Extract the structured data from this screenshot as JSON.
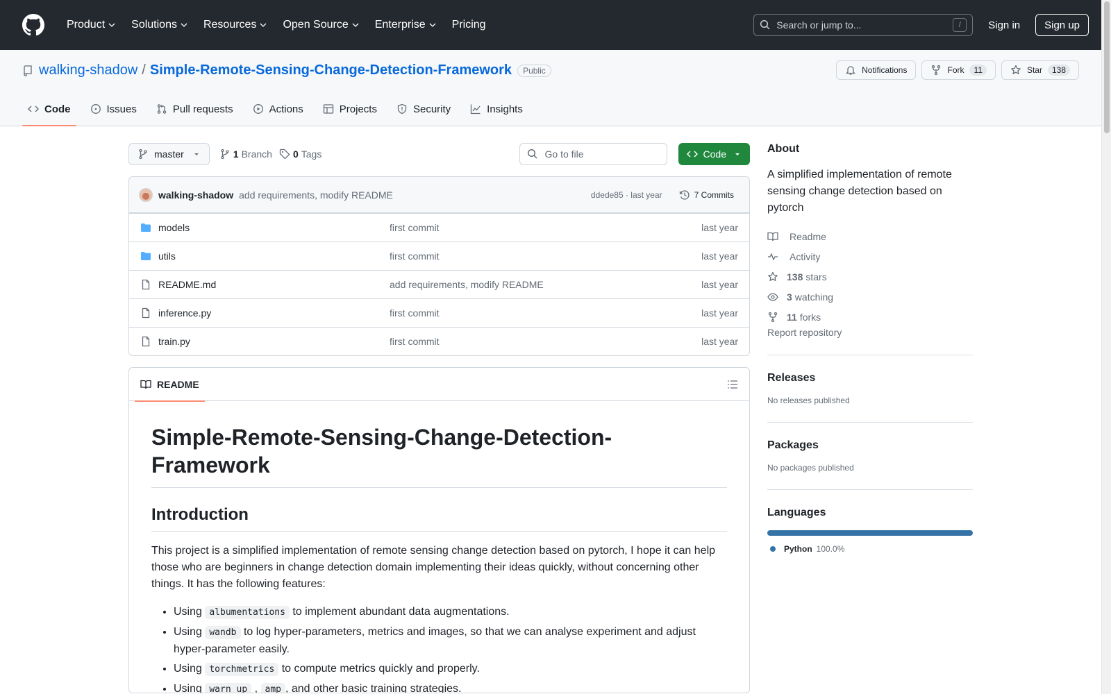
{
  "header": {
    "nav": [
      {
        "label": "Product",
        "caret": true
      },
      {
        "label": "Solutions",
        "caret": true
      },
      {
        "label": "Resources",
        "caret": true
      },
      {
        "label": "Open Source",
        "caret": true
      },
      {
        "label": "Enterprise",
        "caret": true
      },
      {
        "label": "Pricing",
        "caret": false
      }
    ],
    "search_placeholder": "Search or jump to...",
    "search_shortcut": "/",
    "sign_in": "Sign in",
    "sign_up": "Sign up"
  },
  "repo": {
    "owner": "walking-shadow",
    "separator": "/",
    "name": "Simple-Remote-Sensing-Change-Detection-Framework",
    "visibility": "Public",
    "notifications_label": "Notifications",
    "fork_label": "Fork",
    "fork_count": "11",
    "star_label": "Star",
    "star_count": "138",
    "tabs": [
      {
        "label": "Code",
        "icon": "code-icon",
        "active": true
      },
      {
        "label": "Issues",
        "icon": "issue-icon"
      },
      {
        "label": "Pull requests",
        "icon": "pull-request-icon"
      },
      {
        "label": "Actions",
        "icon": "play-icon"
      },
      {
        "label": "Projects",
        "icon": "table-icon"
      },
      {
        "label": "Security",
        "icon": "shield-icon"
      },
      {
        "label": "Insights",
        "icon": "graph-icon"
      }
    ]
  },
  "toolbar": {
    "branch": "master",
    "branch_count": "1",
    "branch_label": "Branch",
    "tag_count": "0",
    "tag_label": "Tags",
    "goto_file_placeholder": "Go to file",
    "code_button": "Code"
  },
  "commit": {
    "author": "walking-shadow",
    "message": "add requirements, modify README",
    "sha_time": "ddede85 · last year",
    "commits_label": "7 Commits"
  },
  "files": [
    {
      "name": "models",
      "type": "folder",
      "message": "first commit",
      "age": "last year"
    },
    {
      "name": "utils",
      "type": "folder",
      "message": "first commit",
      "age": "last year"
    },
    {
      "name": "README.md",
      "type": "file",
      "message": "add requirements, modify README",
      "age": "last year"
    },
    {
      "name": "inference.py",
      "type": "file",
      "message": "first commit",
      "age": "last year"
    },
    {
      "name": "train.py",
      "type": "file",
      "message": "first commit",
      "age": "last year"
    }
  ],
  "readme": {
    "tab_label": "README",
    "title": "Simple-Remote-Sensing-Change-Detection-Framework",
    "intro_heading": "Introduction",
    "intro_text": "This project is a simplified implementation of remote sensing change detection based on pytorch, I hope it can help those who are beginners in change detection domain implementing their ideas quickly, without concerning other things. It has the following features:",
    "features": [
      {
        "pre": "Using ",
        "codes": [
          "albumentations"
        ],
        "post": " to implement abundant data augmentations."
      },
      {
        "pre": "Using ",
        "codes": [
          "wandb"
        ],
        "post": " to log hyper-parameters, metrics and images, so that we can analyse experiment and adjust hyper-parameter easily."
      },
      {
        "pre": "Using ",
        "codes": [
          "torchmetrics"
        ],
        "post": " to compute metrics quickly and properly."
      },
      {
        "pre": "Using ",
        "codes": [
          "warn up",
          "amp"
        ],
        "post": ", and other basic training strategies."
      }
    ]
  },
  "sidebar": {
    "about_heading": "About",
    "description": "A simplified implementation of remote sensing change detection based on pytorch",
    "items": [
      {
        "icon": "book-icon",
        "bold": "",
        "label": "Readme"
      },
      {
        "icon": "pulse-icon",
        "bold": "",
        "label": "Activity"
      },
      {
        "icon": "star-icon",
        "bold": "138",
        "label": "stars"
      },
      {
        "icon": "eye-icon",
        "bold": "3",
        "label": "watching"
      },
      {
        "icon": "fork-icon",
        "bold": "11",
        "label": "forks"
      }
    ],
    "report": "Report repository",
    "releases_heading": "Releases",
    "releases_note": "No releases published",
    "packages_heading": "Packages",
    "packages_note": "No packages published",
    "languages_heading": "Languages",
    "languages": [
      {
        "name": "Python",
        "percent": "100.0%",
        "color": "#3572a5"
      }
    ]
  }
}
